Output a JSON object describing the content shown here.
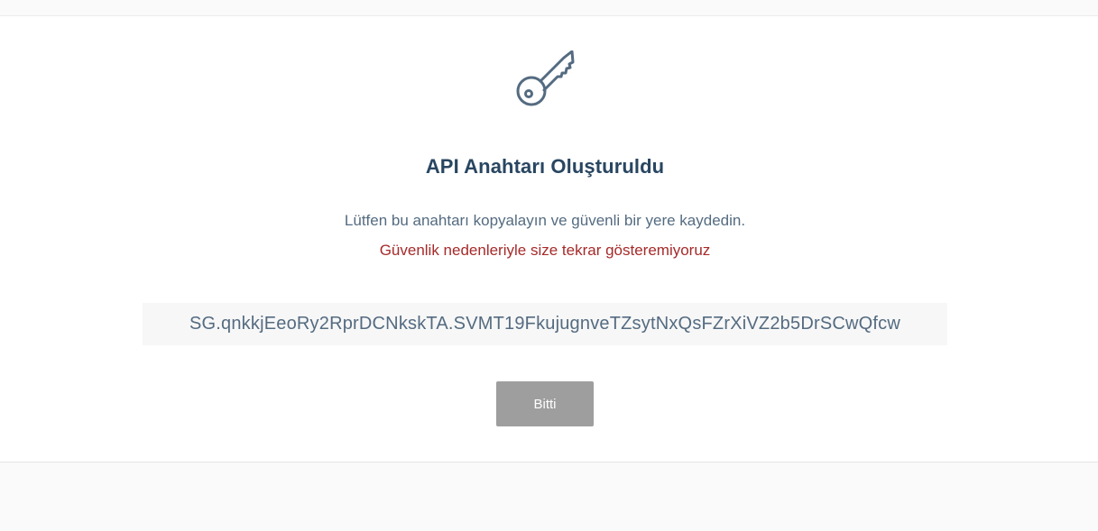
{
  "dialog": {
    "icon": "key-icon",
    "title": "API Anahtarı Oluşturuldu",
    "message": "Lütfen bu anahtarı kopyalayın ve güvenli bir yere kaydedin.",
    "warning": "Güvenlik nedenleriyle size tekrar gösteremiyoruz",
    "api_key": "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",
    "done_label": "Bitti"
  },
  "colors": {
    "title": "#294661",
    "text": "#546b81",
    "warning": "#a62a2a",
    "button_bg": "#9e9e9e",
    "key_box_bg": "#f7f7f7"
  }
}
